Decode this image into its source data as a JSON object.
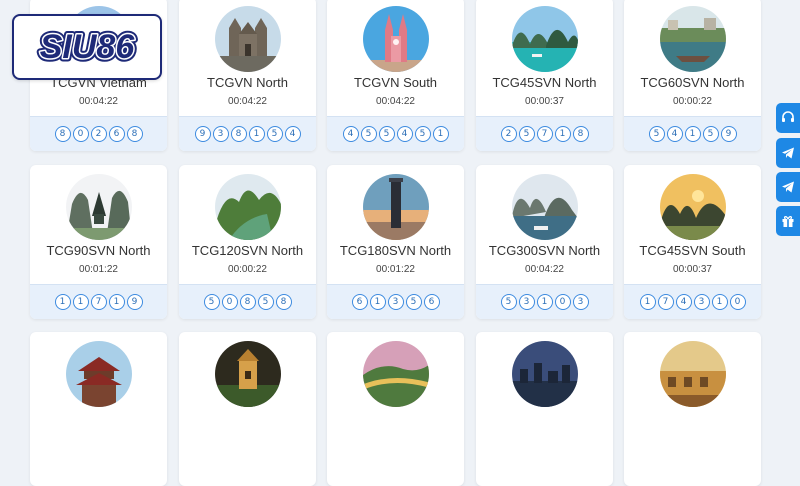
{
  "brand": {
    "logo_text": "SIU86"
  },
  "games": [
    {
      "name": "TCGVN Vietnam",
      "timer": "00:04:22",
      "balls": [
        "8",
        "0",
        "2",
        "6",
        "8"
      ],
      "image": "vietnam-landmark"
    },
    {
      "name": "TCGVN North",
      "timer": "00:04:22",
      "balls": [
        "9",
        "3",
        "8",
        "1",
        "5",
        "4"
      ],
      "image": "stone-church"
    },
    {
      "name": "TCGVN South",
      "timer": "00:04:22",
      "balls": [
        "4",
        "5",
        "5",
        "4",
        "5",
        "1"
      ],
      "image": "pink-cathedral"
    },
    {
      "name": "TCG45SVN North",
      "timer": "00:00:37",
      "balls": [
        "2",
        "5",
        "7",
        "1",
        "8"
      ],
      "image": "bay-islands"
    },
    {
      "name": "TCG60SVN North",
      "timer": "00:00:22",
      "balls": [
        "5",
        "4",
        "1",
        "5",
        "9"
      ],
      "image": "river-boat"
    },
    {
      "name": "TCG90SVN North",
      "timer": "00:01:22",
      "balls": [
        "1",
        "1",
        "7",
        "1",
        "9"
      ],
      "image": "limestone-pagoda"
    },
    {
      "name": "TCG120SVN North",
      "timer": "00:00:22",
      "balls": [
        "5",
        "0",
        "8",
        "5",
        "8"
      ],
      "image": "green-river"
    },
    {
      "name": "TCG180SVN North",
      "timer": "00:01:22",
      "balls": [
        "6",
        "1",
        "3",
        "5",
        "6"
      ],
      "image": "tower-sunset"
    },
    {
      "name": "TCG300SVN North",
      "timer": "00:04:22",
      "balls": [
        "5",
        "3",
        "1",
        "0",
        "3"
      ],
      "image": "karst-bay"
    },
    {
      "name": "TCG45SVN South",
      "timer": "00:00:37",
      "balls": [
        "1",
        "7",
        "4",
        "3",
        "1",
        "0"
      ],
      "image": "sunset-karst"
    },
    {
      "name": "",
      "timer": "",
      "balls": [],
      "image": "red-pagoda"
    },
    {
      "name": "",
      "timer": "",
      "balls": [],
      "image": "turtle-tower"
    },
    {
      "name": "",
      "timer": "",
      "balls": [],
      "image": "golden-bridge"
    },
    {
      "name": "",
      "timer": "",
      "balls": [],
      "image": "city-skyline"
    },
    {
      "name": "",
      "timer": "",
      "balls": [],
      "image": "old-town"
    }
  ],
  "side_buttons": [
    {
      "icon": "headset-icon"
    },
    {
      "icon": "telegram-icon"
    },
    {
      "icon": "telegram-icon"
    },
    {
      "icon": "gift-icon"
    }
  ],
  "colors": {
    "accent": "#1e88e5",
    "ball_border": "#3d8be0",
    "logo_navy": "#1e2a78"
  }
}
